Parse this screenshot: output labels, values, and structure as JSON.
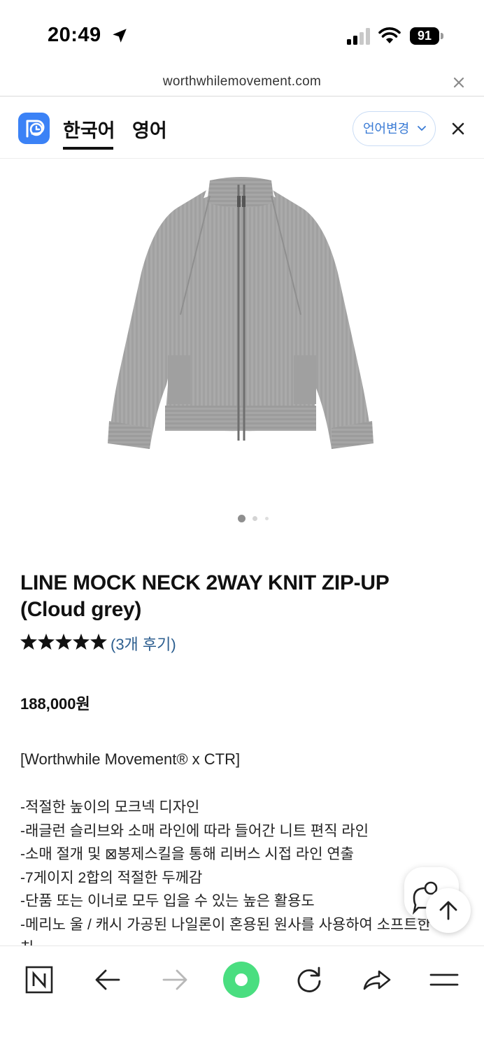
{
  "status_bar": {
    "time": "20:49",
    "battery": "91"
  },
  "browser": {
    "url": "worthwhilemovement.com"
  },
  "translate_bar": {
    "tabs": [
      {
        "label": "한국어",
        "active": true
      },
      {
        "label": "영어",
        "active": false
      }
    ],
    "change_language_label": "언어변경"
  },
  "carousel": {
    "total": 3,
    "current": 1
  },
  "product": {
    "title_line1": "LINE MOCK NECK 2WAY KNIT ZIP-UP",
    "title_line2": "(Cloud grey)",
    "rating": 5,
    "reviews_label": "(3개 후기)",
    "price": "188,000원",
    "collab": "[Worthwhile Movement® x CTR]",
    "features": [
      "-적절한 높이의 모크넥 디자인",
      "-래글런 슬리브와 소매 라인에 따라 들어간 니트 편직 라인",
      "-소매 절개 및 ⊠봉제스킬을 통해 리버스 시접 라인 연출",
      "-7게이지 2합의 적절한 두께감",
      "-단품 또는 이너로 모두 입을 수 있는 높은 활용도",
      "-메리노 울 / 캐시 가공된 나일론이 혼용된 원사를 사용하여 소프트한 터",
      "치"
    ]
  },
  "colors": {
    "accent": "#3b82f6",
    "link": "#2c5e8f",
    "papago_green": "#4ade80"
  },
  "toolbar": {
    "items": [
      "naver-n-icon",
      "back-icon",
      "forward-icon",
      "green-dot-icon",
      "refresh-icon",
      "share-icon",
      "menu-icon"
    ]
  }
}
